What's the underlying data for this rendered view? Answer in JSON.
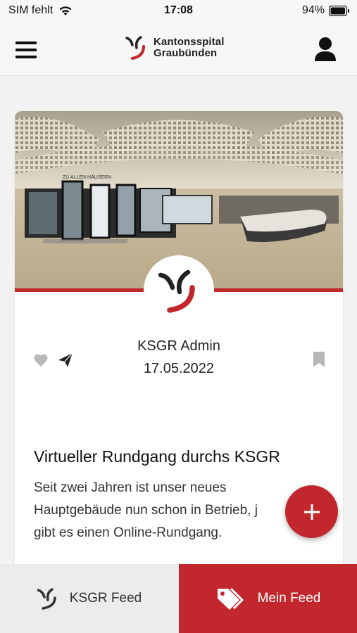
{
  "status_bar": {
    "carrier": "SIM fehlt",
    "time": "17:08",
    "battery": "94%"
  },
  "header": {
    "brand_line1": "Kantonsspital",
    "brand_line2": "Graubünden",
    "icons": {
      "menu": "hamburger-menu-icon",
      "profile": "user-icon"
    }
  },
  "post": {
    "author": "KSGR Admin",
    "date": "17.05.2022",
    "title": "Virtueller Rundgang durchs KSGR",
    "excerpt_line1": "Seit zwei Jahren ist unser neues",
    "excerpt_line2": "Hauptgebäude nun schon in Betrieb, j",
    "excerpt_line3": "gibt es einen Online-Rundgang.",
    "image_sign": "ZU ALLEN HÄUSERN"
  },
  "fab": {
    "icon": "plus-icon"
  },
  "tabs": [
    {
      "label": "KSGR Feed",
      "icon": "ksgr-logo-icon",
      "active": false
    },
    {
      "label": "Mein Feed",
      "icon": "tags-icon",
      "active": true
    }
  ],
  "colors": {
    "accent": "#c1272d",
    "header_bg": "#f7f7f7",
    "tab_inactive_bg": "#ececec"
  }
}
